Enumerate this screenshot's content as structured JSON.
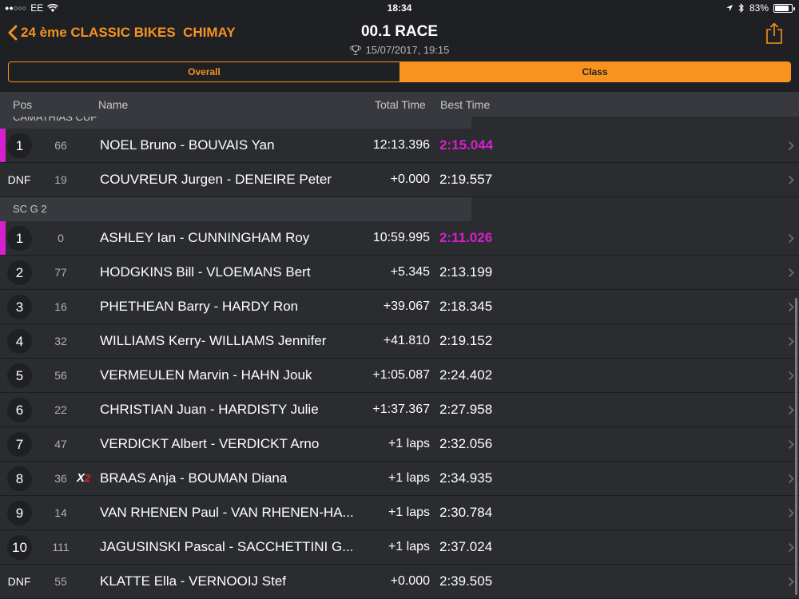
{
  "status": {
    "carrier": "EE",
    "time": "18:34",
    "battery": "83%",
    "battery_level": 0.83
  },
  "nav": {
    "back_label": "24 ème CLASSIC BIKES  CHIMAY",
    "title": "00.1 RACE",
    "date": "15/07/2017, 19:15"
  },
  "segments": [
    "Overall",
    "Class"
  ],
  "columns": {
    "pos": "Pos",
    "name": "Name",
    "total": "Total Time",
    "best": "Best Time"
  },
  "sections": [
    {
      "label": "CAMATHIAS CUP",
      "rows": [
        {
          "pos": "1",
          "num": "66",
          "badge": "",
          "name": "NOEL Bruno - BOUVAIS Yan",
          "total": "12:13.396",
          "best": "2:15.044",
          "fastest": true
        },
        {
          "pos": "DNF",
          "num": "19",
          "badge": "",
          "name": "COUVREUR Jurgen - DENEIRE Peter",
          "total": "+0.000",
          "best": "2:19.557",
          "fastest": false
        }
      ]
    },
    {
      "label": "SC G 2",
      "rows": [
        {
          "pos": "1",
          "num": "0",
          "badge": "",
          "name": "ASHLEY Ian - CUNNINGHAM Roy",
          "total": "10:59.995",
          "best": "2:11.026",
          "fastest": true
        },
        {
          "pos": "2",
          "num": "77",
          "badge": "",
          "name": "HODGKINS Bill - VLOEMANS Bert",
          "total": "+5.345",
          "best": "2:13.199",
          "fastest": false
        },
        {
          "pos": "3",
          "num": "16",
          "badge": "",
          "name": "PHETHEAN Barry - HARDY Ron",
          "total": "+39.067",
          "best": "2:18.345",
          "fastest": false
        },
        {
          "pos": "4",
          "num": "32",
          "badge": "",
          "name": "WILLIAMS Kerry- WILLIAMS Jennifer",
          "total": "+41.810",
          "best": "2:19.152",
          "fastest": false
        },
        {
          "pos": "5",
          "num": "56",
          "badge": "",
          "name": "VERMEULEN Marvin - HAHN Jouk",
          "total": "+1:05.087",
          "best": "2:24.402",
          "fastest": false
        },
        {
          "pos": "6",
          "num": "22",
          "badge": "",
          "name": "CHRISTIAN Juan - HARDISTY Julie",
          "total": "+1:37.367",
          "best": "2:27.958",
          "fastest": false
        },
        {
          "pos": "7",
          "num": "47",
          "badge": "",
          "name": "VERDICKT Albert - VERDICKT Arno",
          "total": "+1 laps",
          "best": "2:32.056",
          "fastest": false
        },
        {
          "pos": "8",
          "num": "36",
          "badge": "X2",
          "name": "BRAAS Anja - BOUMAN Diana",
          "total": "+1 laps",
          "best": "2:34.935",
          "fastest": false
        },
        {
          "pos": "9",
          "num": "14",
          "badge": "",
          "name": "VAN RHENEN Paul - VAN RHENEN-HA...",
          "total": "+1 laps",
          "best": "2:30.784",
          "fastest": false
        },
        {
          "pos": "10",
          "num": "111",
          "badge": "",
          "name": "JAGUSINSKI Pascal - SACCHETTINI G...",
          "total": "+1 laps",
          "best": "2:37.024",
          "fastest": false
        },
        {
          "pos": "DNF",
          "num": "55",
          "badge": "",
          "name": "KLATTE Ella - VERNOOIJ Stef",
          "total": "+0.000",
          "best": "2:39.505",
          "fastest": false
        }
      ]
    }
  ],
  "colors": {
    "accent": "#f7931e",
    "fastest": "#d81fcf",
    "background": "#2b2c30"
  }
}
